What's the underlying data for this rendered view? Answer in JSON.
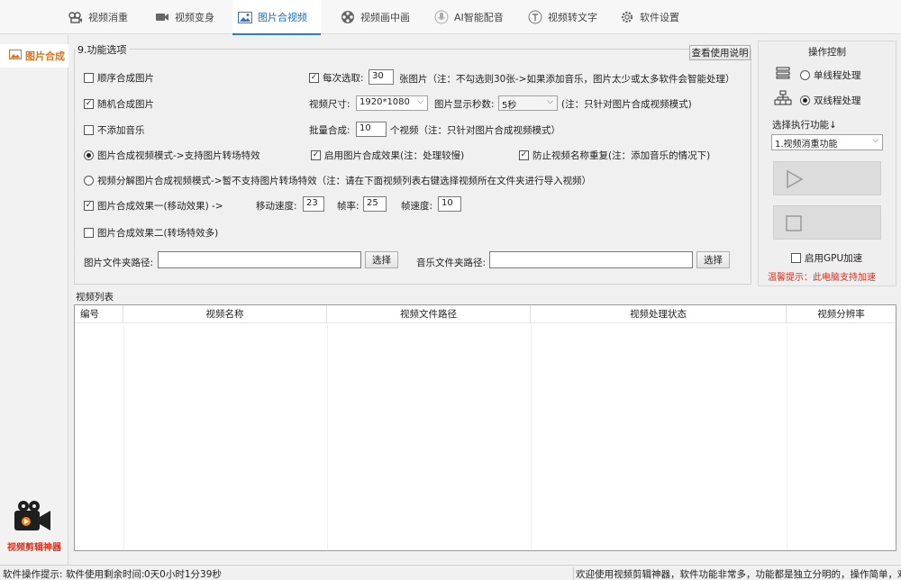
{
  "top_tabs": [
    {
      "label": "视频消重",
      "icon": "video-dedupe-icon"
    },
    {
      "label": "视频变身",
      "icon": "camera-icon"
    },
    {
      "label": "图片合视频",
      "icon": "image-icon",
      "active": true
    },
    {
      "label": "视频画中画",
      "icon": "film-reel-icon"
    },
    {
      "label": "AI智能配音",
      "icon": "microphone-icon"
    },
    {
      "label": "视频转文字",
      "icon": "text-t-icon"
    },
    {
      "label": "软件设置",
      "icon": "gear-icon"
    }
  ],
  "sidebar": {
    "item_label": "图片合成",
    "app_name": "视频剪辑神器"
  },
  "options": {
    "legend": "9.功能选项",
    "help_button": "查看使用说明",
    "sequential": {
      "label": "顺序合成图片",
      "checked": false
    },
    "random": {
      "label": "随机合成图片",
      "checked": true
    },
    "no_music": {
      "label": "不添加音乐",
      "checked": false
    },
    "per_pick": {
      "label": "每次选取:",
      "checked": true,
      "value": "30",
      "suffix": "张图片（注：不勾选则30张->如果添加音乐，图片太少或太多软件会智能处理）"
    },
    "video_size": {
      "label": "视频尺寸:",
      "value": "1920*1080"
    },
    "display_seconds": {
      "label": "图片显示秒数:",
      "value": "5秒",
      "note": "(注：只针对图片合成视频模式)"
    },
    "batch": {
      "label": "批量合成:",
      "value": "10",
      "suffix": "个视频（注：只针对图片合成视频模式）"
    },
    "mode1": {
      "label": "图片合成视频模式->支持图片转场特效",
      "selected": true
    },
    "effect_enable": {
      "label": "启用图片合成效果(注：处理较慢)",
      "checked": true
    },
    "prevent_dup": {
      "label": "防止视频名称重复(注：添加音乐的情况下)",
      "checked": true
    },
    "mode2": {
      "label": "视频分解图片合成视频模式->暂不支持图片转场特效（注：请在下面视频列表右键选择视频所在文件夹进行导入视频）",
      "selected": false
    },
    "effect1": {
      "label": "图片合成效果一(移动效果) ->",
      "checked": true
    },
    "move_speed": {
      "label": "移动速度:",
      "value": "23"
    },
    "frame_rate": {
      "label": "帧率:",
      "value": "25"
    },
    "frame_speed": {
      "label": "帧速度:",
      "value": "10"
    },
    "effect2": {
      "label": "图片合成效果二(转场特效多)",
      "checked": false
    },
    "image_folder": {
      "label": "图片文件夹路径:",
      "value": "",
      "button": "选择"
    },
    "music_folder": {
      "label": "音乐文件夹路径:",
      "value": "",
      "button": "选择"
    }
  },
  "control": {
    "title": "操作控制",
    "single_thread": {
      "label": "单线程处理",
      "selected": false
    },
    "multi_thread": {
      "label": "双线程处理",
      "selected": true
    },
    "select_label": "选择执行功能↓",
    "function_value": "1.视频消重功能",
    "gpu": {
      "label": "启用GPU加速",
      "checked": false
    },
    "tip": "温馨提示：此电脑支持加速"
  },
  "video_list": {
    "legend": "视频列表",
    "columns": [
      "编号",
      "视频名称",
      "视频文件路径",
      "视频处理状态",
      "视频分辨率"
    ],
    "rows": []
  },
  "status_bar": {
    "hint_label": "软件操作提示:",
    "remaining": "软件使用剩余时间:",
    "remaining_value": "0天0小时1分39秒",
    "marquee": "欢迎使用视频剪辑神器，软件功能非常多，功能都是独立分明的，操作简单，欢迎您"
  },
  "colors": {
    "accent": "#2a7ad5",
    "sidebar_active": "#e0701a",
    "warning": "#d2321e"
  }
}
